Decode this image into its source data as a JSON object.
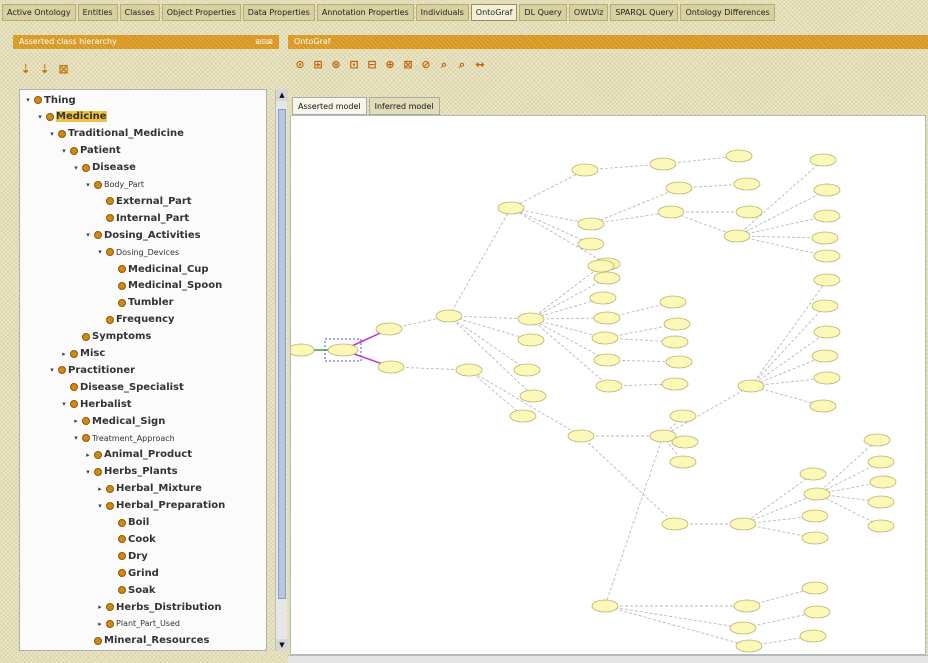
{
  "tabs": [
    {
      "label": "Active Ontology",
      "active": false
    },
    {
      "label": "Entities",
      "active": false
    },
    {
      "label": "Classes",
      "active": false
    },
    {
      "label": "Object Properties",
      "active": false
    },
    {
      "label": "Data Properties",
      "active": false
    },
    {
      "label": "Annotation Properties",
      "active": false
    },
    {
      "label": "Individuals",
      "active": false
    },
    {
      "label": "OntoGraf",
      "active": true
    },
    {
      "label": "DL Query",
      "active": false
    },
    {
      "label": "OWLViz",
      "active": false
    },
    {
      "label": "SPARQL Query",
      "active": false
    },
    {
      "label": "Ontology Differences",
      "active": false
    }
  ],
  "left_panel": {
    "title": "Asserted class hierarchy",
    "dock_label": "⊞⊟⊠",
    "toolbar": [
      "class-add",
      "subclass-add",
      "class-delete"
    ],
    "tree": [
      {
        "label": "Thing",
        "depth": 0,
        "toggle": "▾"
      },
      {
        "label": "Medicine",
        "depth": 1,
        "toggle": "▾",
        "selected": true
      },
      {
        "label": "Traditional_Medicine",
        "depth": 2,
        "toggle": "▾"
      },
      {
        "label": "Patient",
        "depth": 3,
        "toggle": "▾"
      },
      {
        "label": "Disease",
        "depth": 4,
        "toggle": "▾"
      },
      {
        "label": "Body_Part",
        "depth": 5,
        "toggle": "▾",
        "small": true
      },
      {
        "label": "External_Part",
        "depth": 6,
        "toggle": ""
      },
      {
        "label": "Internal_Part",
        "depth": 6,
        "toggle": ""
      },
      {
        "label": "Dosing_Activities",
        "depth": 5,
        "toggle": "▾"
      },
      {
        "label": "Dosing_Devices",
        "depth": 6,
        "toggle": "▾",
        "small": true
      },
      {
        "label": "Medicinal_Cup",
        "depth": 7,
        "toggle": ""
      },
      {
        "label": "Medicinal_Spoon",
        "depth": 7,
        "toggle": ""
      },
      {
        "label": "Tumbler",
        "depth": 7,
        "toggle": ""
      },
      {
        "label": "Frequency",
        "depth": 6,
        "toggle": ""
      },
      {
        "label": "Symptoms",
        "depth": 4,
        "toggle": ""
      },
      {
        "label": "Misc",
        "depth": 3,
        "toggle": "▸"
      },
      {
        "label": "Practitioner",
        "depth": 2,
        "toggle": "▾"
      },
      {
        "label": "Disease_Specialist",
        "depth": 3,
        "toggle": ""
      },
      {
        "label": "Herbalist",
        "depth": 3,
        "toggle": "▾"
      },
      {
        "label": "Medical_Sign",
        "depth": 4,
        "toggle": "▸"
      },
      {
        "label": "Treatment_Approach",
        "depth": 4,
        "toggle": "▾",
        "small": true
      },
      {
        "label": "Animal_Product",
        "depth": 5,
        "toggle": "▸"
      },
      {
        "label": "Herbs_Plants",
        "depth": 5,
        "toggle": "▾"
      },
      {
        "label": "Herbal_Mixture",
        "depth": 6,
        "toggle": "▸"
      },
      {
        "label": "Herbal_Preparation",
        "depth": 6,
        "toggle": "▾"
      },
      {
        "label": "Boil",
        "depth": 7,
        "toggle": ""
      },
      {
        "label": "Cook",
        "depth": 7,
        "toggle": ""
      },
      {
        "label": "Dry",
        "depth": 7,
        "toggle": ""
      },
      {
        "label": "Grind",
        "depth": 7,
        "toggle": ""
      },
      {
        "label": "Soak",
        "depth": 7,
        "toggle": ""
      },
      {
        "label": "Herbs_Distribution",
        "depth": 6,
        "toggle": "▸"
      },
      {
        "label": "Plant_Part_Used",
        "depth": 6,
        "toggle": "▸",
        "small": true
      },
      {
        "label": "Mineral_Resources",
        "depth": 5,
        "toggle": ""
      }
    ]
  },
  "right_panel": {
    "title": "OntoGraf",
    "toolbar": [
      "layout-radial",
      "layout-spring",
      "layout-tree",
      "layout-horizontal",
      "layout-vertical",
      "layout-grid",
      "filter",
      "export",
      "zoom-in",
      "zoom-out",
      "fit"
    ],
    "subtabs": [
      {
        "label": "Asserted model",
        "active": true
      },
      {
        "label": "Inferred model",
        "active": false
      }
    ]
  },
  "colors": {
    "title_bar": "#d9961c",
    "node_fill": "#fcf9b8",
    "node_stroke": "#b9b06a",
    "edge": "#b9b9b9",
    "focus_edge": "#c23ad0",
    "root_edge": "#3aa040"
  }
}
